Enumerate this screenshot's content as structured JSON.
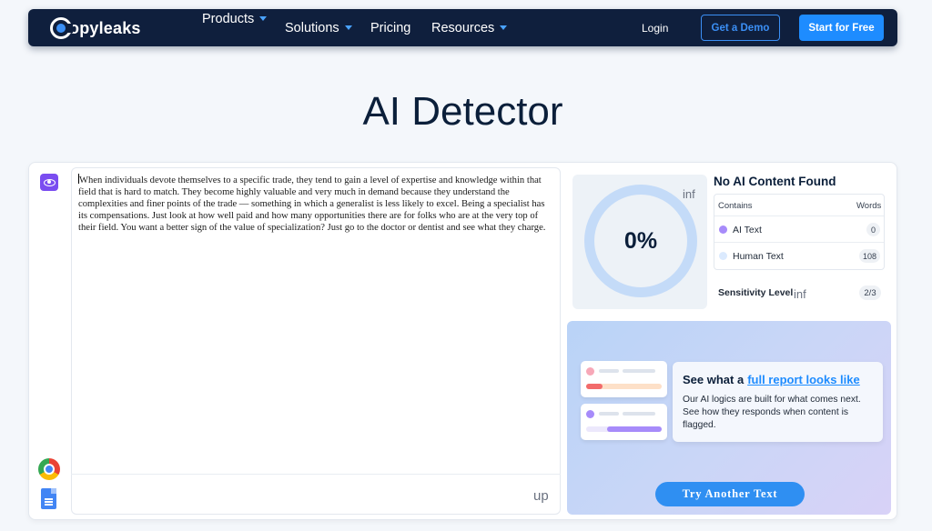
{
  "nav": {
    "logo_text": "opyleaks",
    "menu": [
      {
        "label": "Products",
        "has_dropdown": true
      },
      {
        "label": "Solutions",
        "has_dropdown": true
      },
      {
        "label": "Pricing",
        "has_dropdown": false
      },
      {
        "label": "Resources",
        "has_dropdown": true
      }
    ],
    "login": "Login",
    "demo_button": "Get a Demo",
    "start_button": "Start for Free"
  },
  "page_title": "AI Detector",
  "sidebar": {
    "icons": [
      "eye-icon",
      "chrome-icon",
      "google-docs-icon"
    ]
  },
  "editor": {
    "text": "When individuals devote themselves to a specific trade, they tend to gain a level of expertise and knowledge within that field that is hard to match. They become highly valuable and very much in demand because they understand the complexities and finer points of the trade — something in which a generalist is less likely to excel. Being a specialist has its compensations. Just look at how well paid and how many opportunities there are for folks who are at the very top of their field. You want a better sign of the value of specialization? Just go to the doctor or dentist and see what they charge.",
    "footer_label": "up"
  },
  "result": {
    "score": "0%",
    "score_artifact": "inf",
    "title": "No AI Content Found",
    "table_header": {
      "contains": "Contains",
      "words": "Words"
    },
    "rows": [
      {
        "label": "AI Text",
        "count": "0",
        "color": "#a78bfa"
      },
      {
        "label": "Human Text",
        "count": "108",
        "color": "#dbeafe"
      }
    ],
    "sensitivity_label": "Sensitivity Level",
    "sensitivity_artifact": "inf",
    "sensitivity_value": "2/3"
  },
  "promo": {
    "title_prefix": "See what a",
    "title_link": "full report looks like",
    "text": "Our AI logics are built for what comes next. See how they responds when content is flagged.",
    "button": "Try Another Text"
  },
  "colors": {
    "nav_bg": "#0f1f3d",
    "accent": "#1e8cff",
    "ring": "#c4dbf8",
    "ai_purple": "#7a4df0"
  }
}
